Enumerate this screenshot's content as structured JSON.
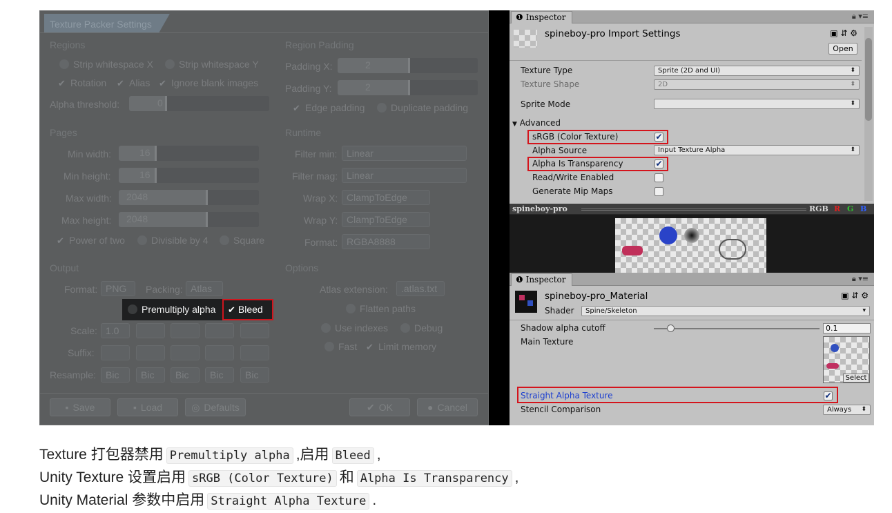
{
  "texture_packer": {
    "tab_title": "Texture Packer Settings",
    "regions": {
      "title": "Regions",
      "strip_x": "Strip whitespace X",
      "strip_y": "Strip whitespace Y",
      "rotation": "Rotation",
      "alias": "Alias",
      "ignore_blank": "Ignore blank images",
      "alpha_threshold_label": "Alpha threshold:",
      "alpha_threshold_value": "0"
    },
    "region_padding": {
      "title": "Region Padding",
      "padding_x_label": "Padding X:",
      "padding_x_value": "2",
      "padding_y_label": "Padding Y:",
      "padding_y_value": "2",
      "edge_padding": "Edge padding",
      "duplicate_padding": "Duplicate padding"
    },
    "pages": {
      "title": "Pages",
      "min_width_label": "Min width:",
      "min_width_value": "16",
      "min_height_label": "Min height:",
      "min_height_value": "16",
      "max_width_label": "Max width:",
      "max_width_value": "2048",
      "max_height_label": "Max height:",
      "max_height_value": "2048",
      "power_of_two": "Power of two",
      "divisible_by_4": "Divisible by 4",
      "square": "Square"
    },
    "runtime": {
      "title": "Runtime",
      "filter_min_label": "Filter min:",
      "filter_min_value": "Linear",
      "filter_mag_label": "Filter mag:",
      "filter_mag_value": "Linear",
      "wrap_x_label": "Wrap X:",
      "wrap_x_value": "ClampToEdge",
      "wrap_y_label": "Wrap Y:",
      "wrap_y_value": "ClampToEdge",
      "format_label": "Format:",
      "format_value": "RGBA8888"
    },
    "output": {
      "title": "Output",
      "format_label": "Format:",
      "format_value": "PNG",
      "packing_label": "Packing:",
      "packing_value": "Atlas",
      "premultiply_alpha": "Premultiply alpha",
      "bleed": "Bleed",
      "scale_label": "Scale:",
      "scale_value": "1.0",
      "suffix_label": "Suffix:",
      "resample_label": "Resample:",
      "resample_values": [
        "Bic",
        "Bic",
        "Bic",
        "Bic",
        "Bic"
      ]
    },
    "options": {
      "title": "Options",
      "atlas_extension_label": "Atlas extension:",
      "atlas_extension_value": ".atlas.txt",
      "flatten_paths": "Flatten paths",
      "use_indexes": "Use indexes",
      "debug": "Debug",
      "fast": "Fast",
      "limit_memory": "Limit memory"
    },
    "buttons": {
      "save": "Save",
      "load": "Load",
      "defaults": "Defaults",
      "ok": "OK",
      "cancel": "Cancel"
    }
  },
  "unity_import": {
    "tab": "Inspector",
    "title": "spineboy-pro Import Settings",
    "open_button": "Open",
    "texture_type_label": "Texture Type",
    "texture_type_value": "Sprite (2D and UI)",
    "texture_shape_label": "Texture Shape",
    "texture_shape_value": "2D",
    "sprite_mode_label": "Sprite Mode",
    "sprite_mode_value": "",
    "advanced_label": "Advanced",
    "srgb_label": "sRGB (Color Texture)",
    "alpha_source_label": "Alpha Source",
    "alpha_source_value": "Input Texture Alpha",
    "alpha_is_transparency_label": "Alpha Is Transparency",
    "read_write_label": "Read/Write Enabled",
    "mipmaps_label": "Generate Mip Maps"
  },
  "preview": {
    "name": "spineboy-pro",
    "channels": [
      "RGB",
      "R",
      "G",
      "B"
    ],
    "channel_colors": [
      "#d8d8d8",
      "#e02020",
      "#30c030",
      "#3060ff"
    ]
  },
  "unity_material": {
    "tab": "Inspector",
    "title": "spineboy-pro_Material",
    "shader_label": "Shader",
    "shader_value": "Spine/Skeleton",
    "shadow_cutoff_label": "Shadow alpha cutoff",
    "shadow_cutoff_value": "0.1",
    "shadow_cutoff_level": 0.1,
    "main_texture_label": "Main Texture",
    "select_button": "Select",
    "straight_alpha_label": "Straight Alpha Texture",
    "stencil_label": "Stencil Comparison",
    "stencil_value": "Always"
  },
  "caption": {
    "line1_pre": "Texture 打包器禁用",
    "line1_code1": "Premultiply alpha",
    "line1_mid": ",启用",
    "line1_code2": "Bleed",
    "line1_post": ",",
    "line2_pre": "Unity Texture 设置启用",
    "line2_code1": "sRGB (Color Texture)",
    "line2_mid": "和",
    "line2_code2": "Alpha Is Transparency",
    "line2_post": ",",
    "line3_pre": "Unity Material 参数中启用",
    "line3_code1": "Straight Alpha Texture",
    "line3_post": "."
  }
}
